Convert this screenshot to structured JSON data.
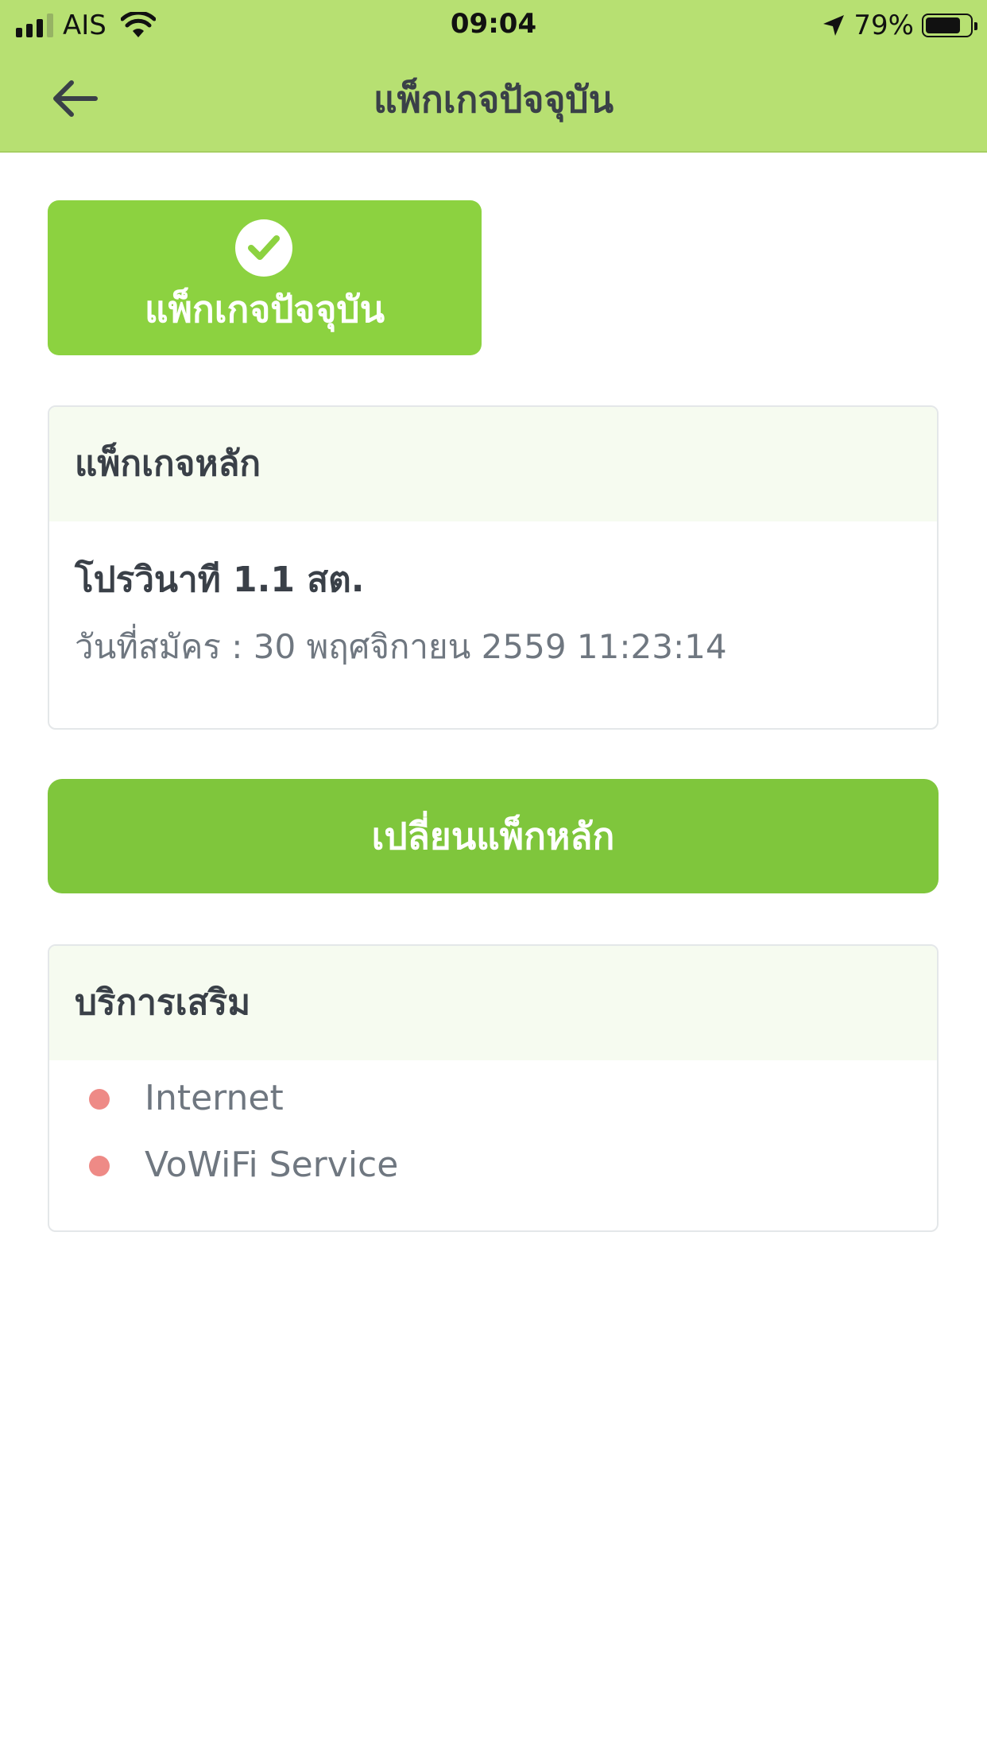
{
  "status_bar": {
    "carrier": "AIS",
    "time": "09:04",
    "battery_percent": "79%",
    "battery_level": 0.79,
    "signal_bars": 3,
    "icons": [
      "signal-icon",
      "wifi-icon",
      "location-arrow-icon",
      "battery-icon"
    ]
  },
  "nav": {
    "title": "แพ็กเกจปัจจุบัน",
    "back_icon": "arrow-left-icon"
  },
  "current_tile": {
    "label": "แพ็กเกจปัจจุบัน",
    "icon": "check-circle-icon"
  },
  "main_package": {
    "header": "แพ็กเกจหลัก",
    "name": "โปรวินาที 1.1 สต.",
    "subscribed": "วันที่สมัคร : 30 พฤศจิกายน 2559 11:23:14"
  },
  "change_button": {
    "label": "เปลี่ยนแพ็กหลัก"
  },
  "extra_services": {
    "header": "บริการเสริม",
    "items": [
      {
        "label": "Internet"
      },
      {
        "label": "VoWiFi Service"
      }
    ]
  },
  "colors": {
    "header_bg": "#b7e072",
    "tile_green": "#8cd240",
    "button_green": "#7fc63c",
    "card_header_bg": "#f6fbf0",
    "bullet_red": "#ee8a86"
  }
}
